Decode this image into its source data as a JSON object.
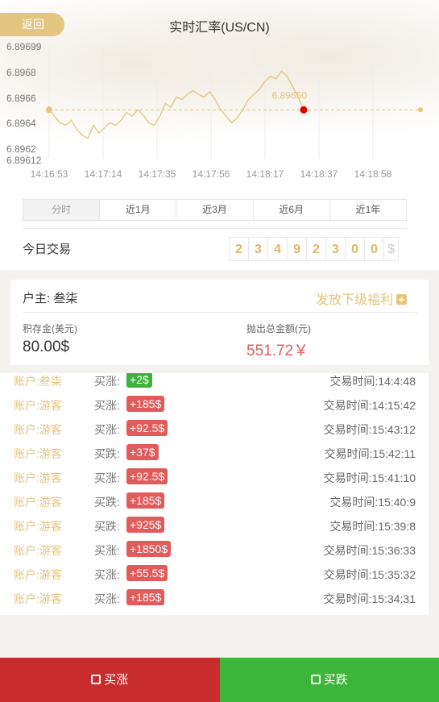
{
  "header": {
    "back_label": "返回",
    "title": "实时汇率(US/CN)"
  },
  "chart_data": {
    "type": "line",
    "y_ticks": [
      "6.89699",
      "6.8968",
      "6.8966",
      "6.8964",
      "6.8962",
      "6.89612"
    ],
    "x_ticks": [
      "14:16:53",
      "14:17:14",
      "14:17:35",
      "14:17:56",
      "14:18:17",
      "14:18:37",
      "14:18:58"
    ],
    "ylim": [
      6.89612,
      6.89699
    ],
    "current_value_label": "6.89650",
    "reference_line": 6.8965,
    "series": [
      {
        "values": [
          6.8965,
          6.89645,
          6.8964,
          6.89638,
          6.89642,
          6.89635,
          6.8963,
          6.89628,
          6.89638,
          6.89632,
          6.89636,
          6.8964,
          6.89638,
          6.89642,
          6.89648,
          6.89645,
          6.8965,
          6.89646,
          6.8964,
          6.89638,
          6.89645,
          6.89655,
          6.89652,
          6.8966,
          6.89658,
          6.89662,
          6.89665,
          6.89662,
          6.8966,
          6.89664,
          6.89658,
          6.8965,
          6.89645,
          6.8964,
          6.89644,
          6.8965,
          6.89658,
          6.89662,
          6.89666,
          6.89672,
          6.89676,
          6.89674,
          6.8968,
          6.89676,
          6.89668,
          6.8966,
          6.8965
        ]
      }
    ],
    "line_color": "#e3c57f",
    "marker_color": "#e00000"
  },
  "ranges": [
    "分时",
    "近1月",
    "近3月",
    "近6月",
    "近1年"
  ],
  "today": {
    "label": "今日交易",
    "digits": [
      "2",
      "3",
      "4",
      "9",
      "2",
      "3",
      "0",
      "0"
    ],
    "currency": "$"
  },
  "owner": {
    "label": "户主: 叁柒",
    "welfare_label": "发放下级福利",
    "welfare_icon": "plus-icon",
    "deposit_label": "积存金(美元)",
    "deposit_value": "80.00$",
    "payout_label": "抛出总金额(元)",
    "payout_value": "551.72￥"
  },
  "trades": [
    {
      "account": "账户:叁柒",
      "action": "买涨:",
      "amount": "+2$",
      "time": "交易时间:14:4:48",
      "color": "green"
    },
    {
      "account": "账户:游客",
      "action": "买涨:",
      "amount": "+185$",
      "time": "交易时间:14:15:42",
      "color": "red"
    },
    {
      "account": "账户:游客",
      "action": "买涨:",
      "amount": "+92.5$",
      "time": "交易时间:15:43:12",
      "color": "red"
    },
    {
      "account": "账户:游客",
      "action": "买跌:",
      "amount": "+37$",
      "time": "交易时间:15:42:11",
      "color": "red"
    },
    {
      "account": "账户:游客",
      "action": "买涨:",
      "amount": "+92.5$",
      "time": "交易时间:15:41:10",
      "color": "red"
    },
    {
      "account": "账户:游客",
      "action": "买跌:",
      "amount": "+185$",
      "time": "交易时间:15:40:9",
      "color": "red"
    },
    {
      "account": "账户:游客",
      "action": "买跌:",
      "amount": "+925$",
      "time": "交易时间:15:39:8",
      "color": "red"
    },
    {
      "account": "账户:游客",
      "action": "买涨:",
      "amount": "+1850$",
      "time": "交易时间:15:36:33",
      "color": "red"
    },
    {
      "account": "账户:游客",
      "action": "买涨:",
      "amount": "+55.5$",
      "time": "交易时间:15:35:32",
      "color": "red"
    },
    {
      "account": "账户:游客",
      "action": "买涨:",
      "amount": "+185$",
      "time": "交易时间:15:34:31",
      "color": "red"
    }
  ],
  "bottom": {
    "buy_up_label": "买涨",
    "buy_up_icon": "arrow-up-box-icon",
    "buy_down_label": "买跌",
    "buy_down_icon": "arrow-down-box-icon"
  },
  "colors": {
    "gold": "#e3c57f",
    "red": "#c92c2c",
    "green": "#3db539",
    "badge_red": "#e25b5b"
  }
}
